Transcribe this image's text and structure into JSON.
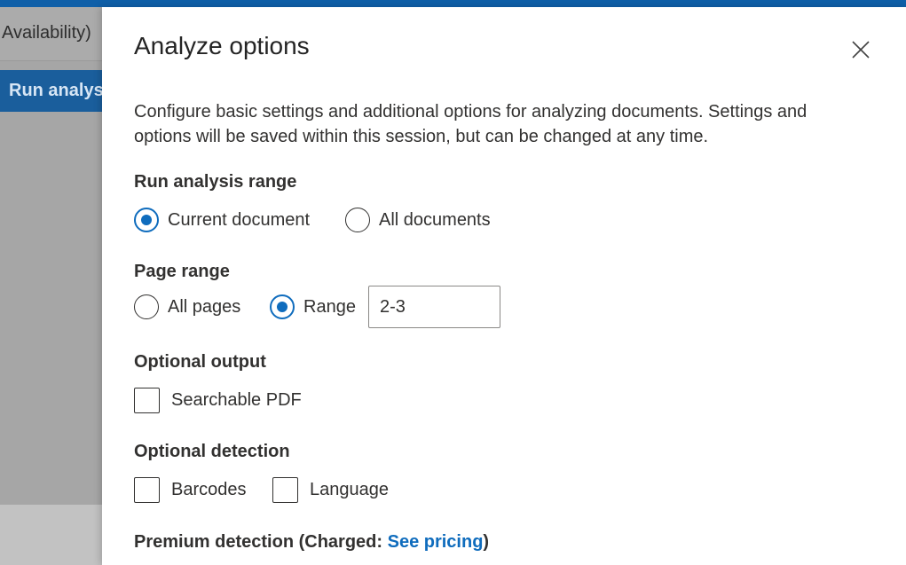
{
  "background": {
    "availability_text": "Availability)",
    "run_button_text": "Run analysis"
  },
  "dialog": {
    "title": "Analyze options",
    "description": "Configure basic settings and additional options for analyzing documents. Settings and options will be saved within this session, but can be changed at any time.",
    "run_analysis_range": {
      "label": "Run analysis range",
      "options": [
        {
          "label": "Current document",
          "checked": true
        },
        {
          "label": "All documents",
          "checked": false
        }
      ]
    },
    "page_range": {
      "label": "Page range",
      "options": [
        {
          "label": "All pages",
          "checked": false
        },
        {
          "label": "Range",
          "checked": true
        }
      ],
      "range_value": "2-3"
    },
    "optional_output": {
      "label": "Optional output",
      "options": [
        {
          "label": "Searchable PDF",
          "checked": false
        }
      ]
    },
    "optional_detection": {
      "label": "Optional detection",
      "options": [
        {
          "label": "Barcodes",
          "checked": false
        },
        {
          "label": "Language",
          "checked": false
        }
      ]
    },
    "premium_detection": {
      "prefix": "Premium detection (Charged: ",
      "link_text": "See pricing",
      "suffix": ")"
    }
  },
  "colors": {
    "accent": "#0f6cbd",
    "overlay": "#a6a6a6",
    "topbar": "#0f5fa8"
  }
}
